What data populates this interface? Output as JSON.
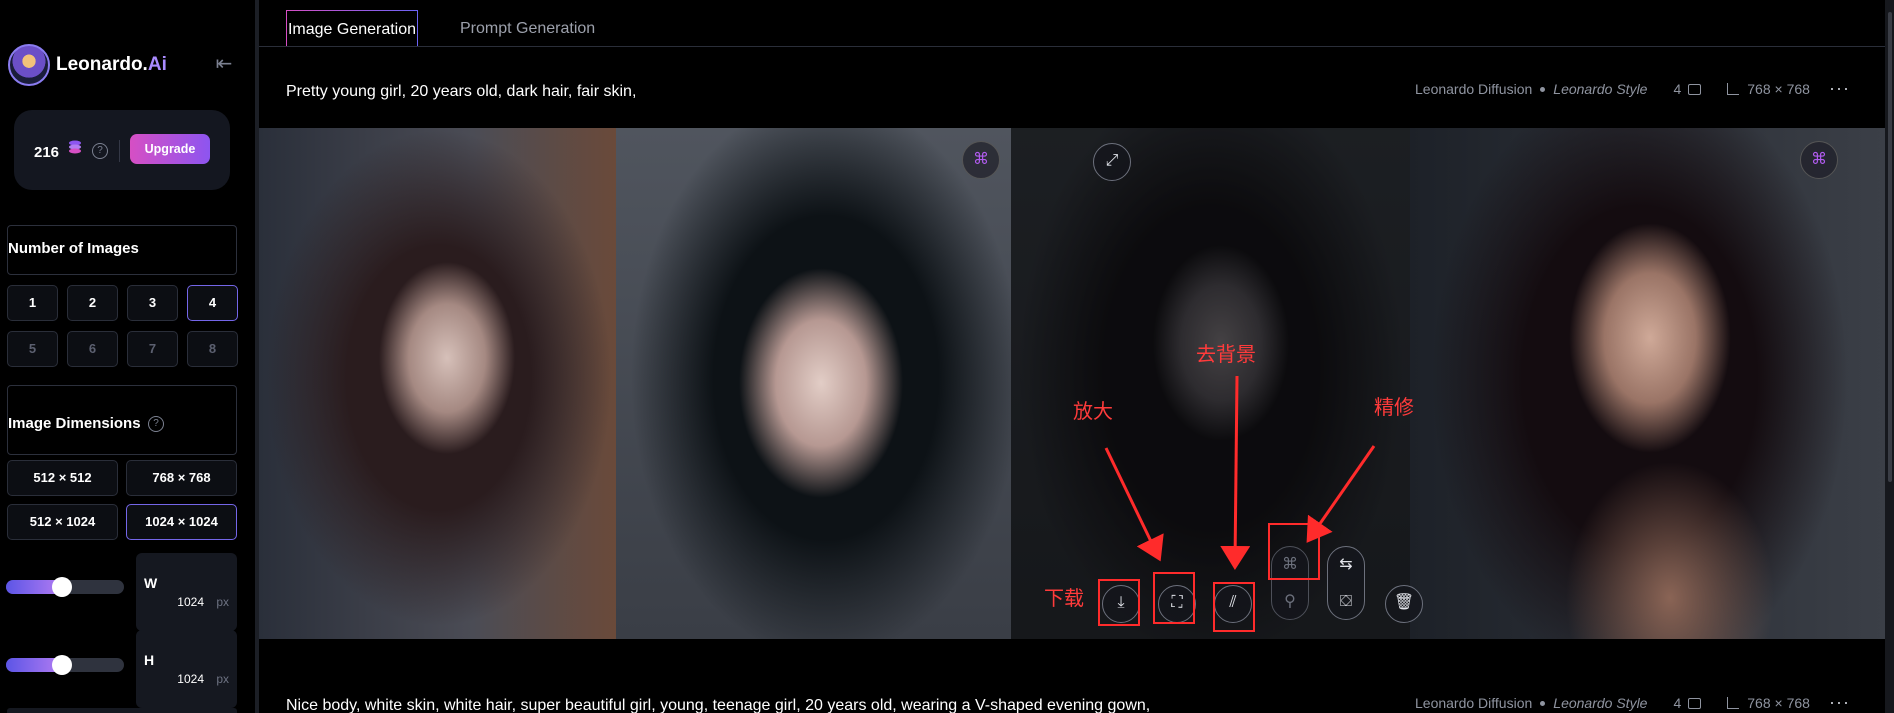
{
  "app": {
    "name": "Leonardo.",
    "name_suffix": "Ai",
    "collapse_icon": "collapse-left-icon"
  },
  "tokens": {
    "count": "216",
    "upgrade_label": "Upgrade",
    "help": "?"
  },
  "sidebar": {
    "num_images_title": "Number of Images",
    "num_images": [
      "1",
      "2",
      "3",
      "4",
      "5",
      "6",
      "7",
      "8"
    ],
    "num_images_selected": "4",
    "num_images_enabled_max": 4,
    "dimensions_title": "Image Dimensions",
    "dimensions_help": "?",
    "dimensions": [
      "512 × 512",
      "768 × 768",
      "512 × 1024",
      "1024 × 1024"
    ],
    "dimensions_selected": "1024 × 1024",
    "width": {
      "label": "W",
      "value": "1024",
      "unit": "px",
      "level": 0.42
    },
    "height": {
      "label": "H",
      "value": "1024",
      "unit": "px",
      "level": 0.42
    }
  },
  "tabs": [
    {
      "label": "Image Generation",
      "active": true
    },
    {
      "label": "Prompt Generation",
      "active": false
    }
  ],
  "generations": [
    {
      "prompt": "Pretty young girl, 20 years old, dark hair, fair skin,",
      "model": "Leonardo Diffusion",
      "style": "Leonardo Style",
      "count": "4",
      "size": "768 × 768",
      "more": "···"
    },
    {
      "prompt": "Nice body, white skin, white hair, super beautiful girl, young, teenage girl, 20 years old, wearing a V-shaped evening gown,",
      "model": "Leonardo Diffusion",
      "style": "Leonardo Style",
      "count": "4",
      "size": "768 × 768",
      "more": "···"
    }
  ],
  "image_actions": {
    "expand": "expand-icon",
    "download": "download-icon",
    "upscale": "upscale-icon",
    "remove_bg": "remove-background-icon",
    "refine": "refine-icon",
    "variation": "variation-icon",
    "swap": "swap-icon",
    "crop": "crop-icon",
    "delete": "trash-icon"
  },
  "annotations": {
    "download": "下载",
    "upscale": "放大",
    "remove_bg": "去背景",
    "refine": "精修"
  },
  "colors": {
    "accent_start": "#d64fc4",
    "accent_end": "#8d55f0",
    "selected_border": "#7466e8",
    "annotation_red": "#ff2b2b"
  }
}
